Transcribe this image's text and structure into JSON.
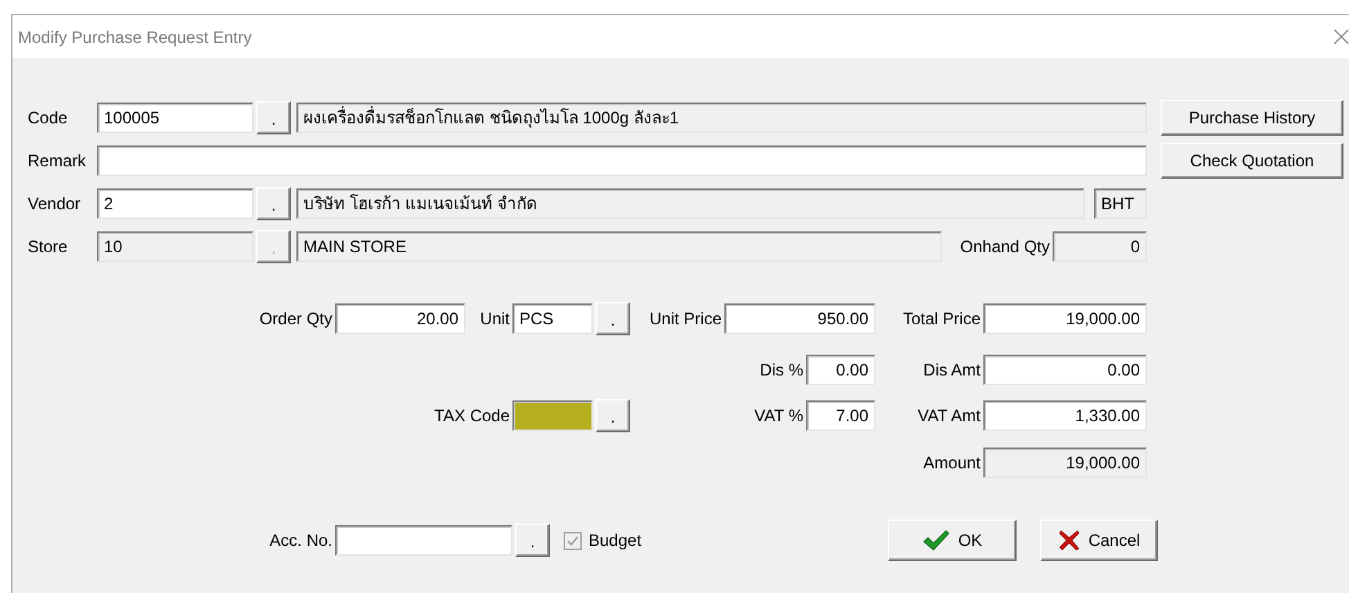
{
  "window": {
    "title": "Modify Purchase Request Entry"
  },
  "code": {
    "label": "Code",
    "value": "100005",
    "lookup": {
      "label": ".",
      "disabled": false
    },
    "description": "ผงเครื่องดื่มรสช็อกโกแลต ชนิดถุงไมโล 1000g ลังละ1"
  },
  "remark": {
    "label": "Remark"
  },
  "vendor": {
    "label": "Vendor",
    "value": "2",
    "lookup": {
      "label": ".",
      "disabled": false
    },
    "description": "บริษัท โฮเรก้า แมเนจเม้นท์ จำกัด",
    "currency": "BHT"
  },
  "store": {
    "label": "Store",
    "value": "10",
    "disabled": true,
    "lookup": {
      "label": ".",
      "disabled": true
    },
    "description": "MAIN STORE",
    "onhand_label": "Onhand Qty",
    "onhand_value": "0"
  },
  "side_buttons": [
    {
      "label": "Purchase History"
    },
    {
      "label": "Check Quotation"
    }
  ],
  "order_qty": {
    "label": "Order Qty",
    "value": "20.00"
  },
  "unit": {
    "label": "Unit",
    "value": "PCS",
    "lookup": {
      "label": ".",
      "disabled": false
    }
  },
  "unit_price": {
    "label": "Unit Price",
    "value": "950.00"
  },
  "total_price": {
    "label": "Total Price",
    "value": "19,000.00"
  },
  "dis_pct": {
    "label": "Dis %",
    "value": "0.00"
  },
  "dis_amt": {
    "label": "Dis Amt",
    "value": "0.00"
  },
  "tax_code": {
    "label": "TAX Code",
    "color": "#b5af1e",
    "lookup": {
      "label": ".",
      "disabled": false
    }
  },
  "vat_pct": {
    "label": "VAT %",
    "value": "7.00"
  },
  "vat_amt": {
    "label": "VAT Amt",
    "value": "1,330.00"
  },
  "amount": {
    "label": "Amount",
    "value": "19,000.00"
  },
  "acc_no": {
    "label": "Acc. No.",
    "lookup": {
      "label": ".",
      "disabled": false
    }
  },
  "budget": {
    "label": "Budget",
    "checked": true,
    "disabled": true
  },
  "buttons": [
    {
      "kind": "ok",
      "label": "OK"
    },
    {
      "kind": "cancel",
      "label": "Cancel"
    }
  ]
}
